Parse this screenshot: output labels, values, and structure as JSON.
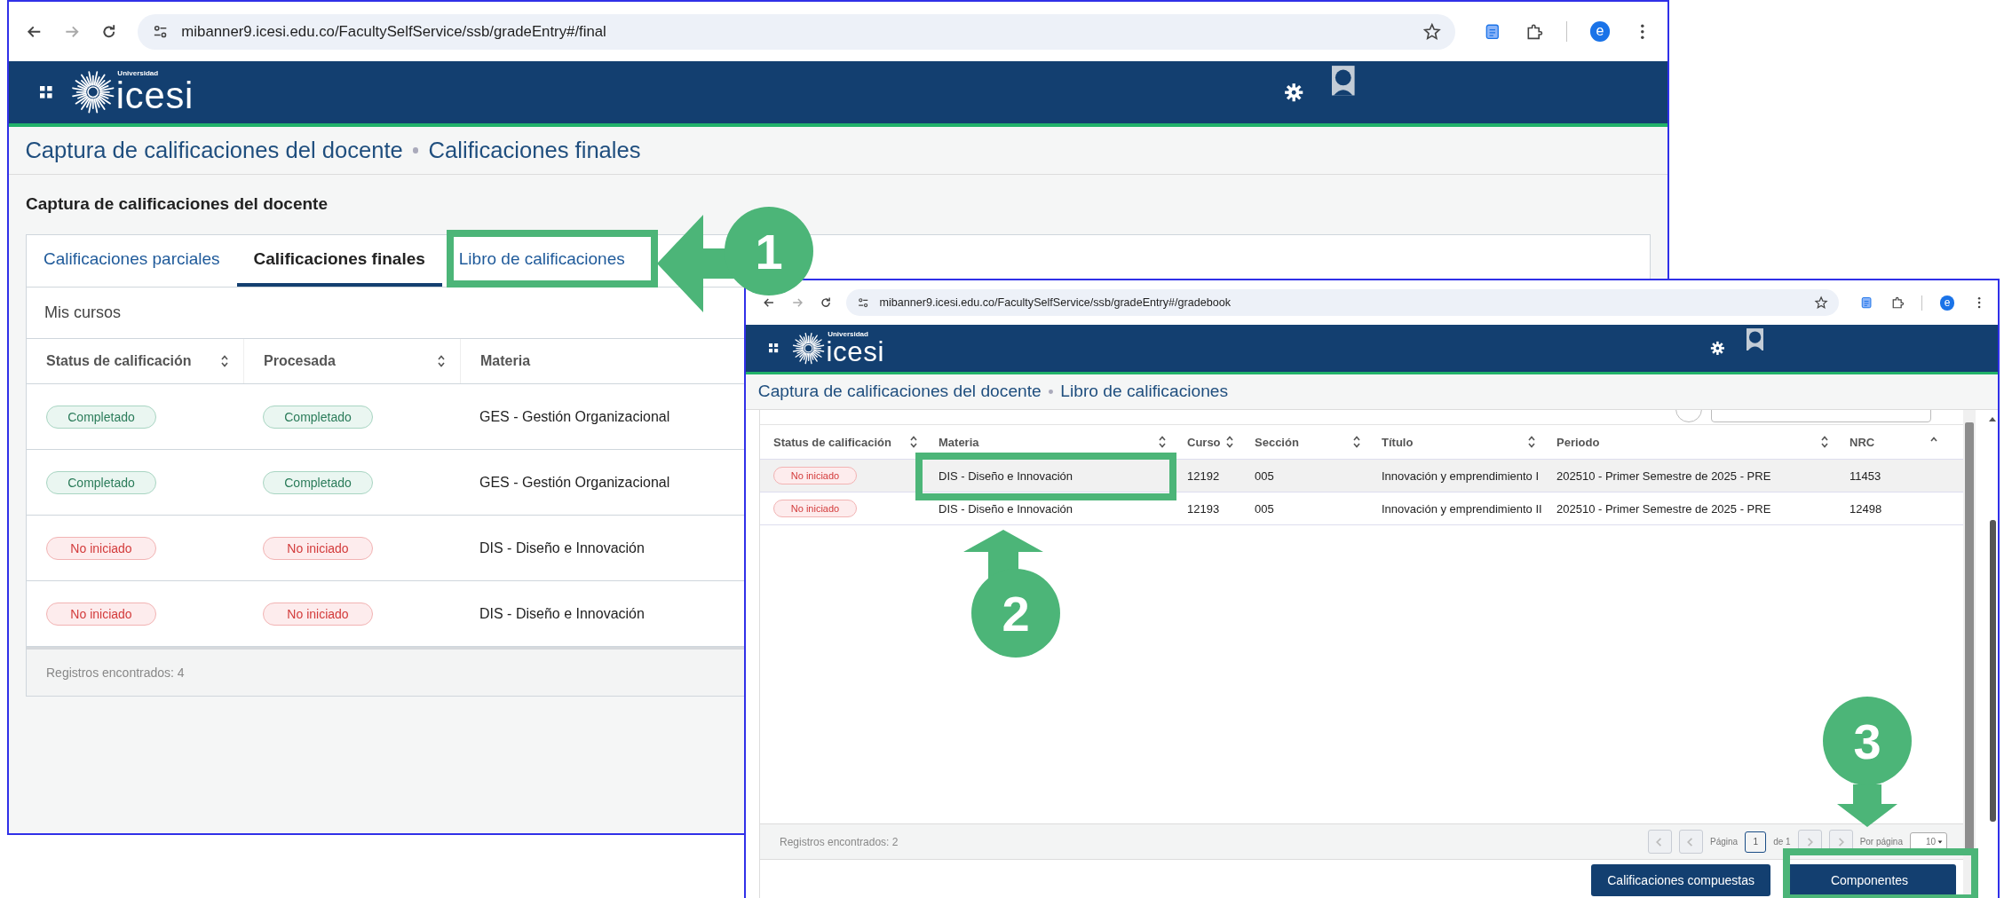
{
  "back_window": {
    "browser": {
      "url": "mibanner9.icesi.edu.co/FacultySelfService/ssb/gradeEntry#/final",
      "profile_initial": "e"
    },
    "brand": {
      "caption": "Universidad",
      "name": "icesi"
    },
    "breadcrumb": [
      "Captura de calificaciones del docente",
      "Calificaciones finales"
    ],
    "page_title": "Captura de calificaciones del docente",
    "tabs": [
      {
        "label": "Calificaciones parciales",
        "selected": false
      },
      {
        "label": "Calificaciones finales",
        "selected": true
      },
      {
        "label": "Libro de calificaciones",
        "selected": false
      }
    ],
    "section_title": "Mis cursos",
    "table": {
      "columns": [
        {
          "label": "Status de calificación",
          "kind": "sortable"
        },
        {
          "label": "Procesada",
          "kind": "sortable"
        },
        {
          "label": "Materia",
          "kind": "plain"
        }
      ],
      "rows": [
        {
          "cells": [
            {
              "kind": "completed_badge",
              "text": "Completado"
            },
            {
              "kind": "completed_badge",
              "text": "Completado"
            },
            {
              "kind": "text",
              "text": "GES - Gestión Organizacional"
            }
          ]
        },
        {
          "cells": [
            {
              "kind": "completed_badge",
              "text": "Completado"
            },
            {
              "kind": "completed_badge",
              "text": "Completado"
            },
            {
              "kind": "text",
              "text": "GES - Gestión Organizacional"
            }
          ]
        },
        {
          "cells": [
            {
              "kind": "pending_badge",
              "text": "No iniciado"
            },
            {
              "kind": "pending_badge",
              "text": "No iniciado"
            },
            {
              "kind": "text",
              "text": "DIS - Diseño e Innovación"
            }
          ]
        },
        {
          "cells": [
            {
              "kind": "pending_badge",
              "text": "No iniciado"
            },
            {
              "kind": "pending_badge",
              "text": "No iniciado"
            },
            {
              "kind": "text",
              "text": "DIS - Diseño e Innovación"
            }
          ]
        }
      ]
    },
    "records": "Registros encontrados: 4"
  },
  "front_window": {
    "browser": {
      "url": "mibanner9.icesi.edu.co/FacultySelfService/ssb/gradeEntry#/gradebook",
      "profile_initial": "e"
    },
    "brand": {
      "caption": "Universidad",
      "name": "icesi"
    },
    "breadcrumb": [
      "Captura de calificaciones del docente",
      "Libro de calificaciones"
    ],
    "table": {
      "columns": [
        {
          "label": "Status de calificación",
          "kind": "sortable"
        },
        {
          "label": "Materia",
          "kind": "sortable"
        },
        {
          "label": "Curso",
          "kind": "sortable"
        },
        {
          "label": "Sección",
          "kind": "sortable"
        },
        {
          "label": "Título",
          "kind": "sortable"
        },
        {
          "label": "Periodo",
          "kind": "sortable"
        },
        {
          "label": "NRC",
          "kind": "sorted_ascending"
        }
      ],
      "rows": [
        {
          "selected": true,
          "cells": [
            {
              "kind": "pending_badge",
              "text": "No iniciado"
            },
            {
              "kind": "text",
              "text": "DIS - Diseño e Innovación"
            },
            {
              "kind": "text",
              "text": "12192"
            },
            {
              "kind": "text",
              "text": "005"
            },
            {
              "kind": "text",
              "text": "Innovación y emprendimiento I"
            },
            {
              "kind": "text",
              "text": "202510 - Primer Semestre de 2025 - PRE"
            },
            {
              "kind": "text",
              "text": "11453"
            }
          ]
        },
        {
          "selected": false,
          "cells": [
            {
              "kind": "pending_badge",
              "text": "No iniciado"
            },
            {
              "kind": "text",
              "text": "DIS - Diseño e Innovación"
            },
            {
              "kind": "text",
              "text": "12193"
            },
            {
              "kind": "text",
              "text": "005"
            },
            {
              "kind": "text",
              "text": "Innovación y emprendimiento II"
            },
            {
              "kind": "text",
              "text": "202510 - Primer Semestre de 2025 - PRE"
            },
            {
              "kind": "text",
              "text": "12498"
            }
          ]
        }
      ]
    },
    "records": "Registros encontrados: 2",
    "pager": {
      "page_label": "Página",
      "page": "1",
      "of_label": "de 1",
      "per_page_label": "Por página",
      "per_page": "10"
    },
    "buttons": [
      {
        "label": "Calificaciones compuestas"
      },
      {
        "label": "Componentes"
      }
    ]
  },
  "annotations": [
    {
      "number": "1"
    },
    {
      "number": "2"
    },
    {
      "number": "3"
    }
  ]
}
